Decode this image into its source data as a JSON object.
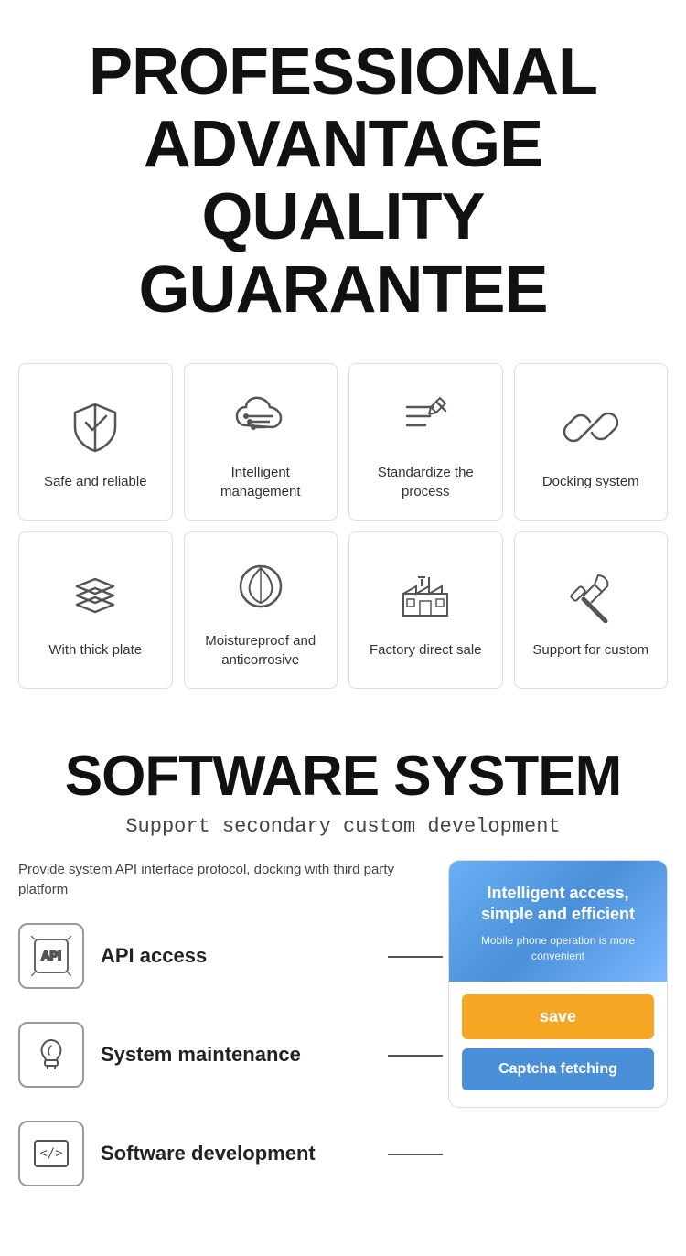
{
  "header": {
    "line1": "PROFESSIONAL",
    "line2": "ADVANTAGE",
    "line3": "QUALITY GUARANTEE"
  },
  "grid": {
    "row1": [
      {
        "id": "safe-reliable",
        "label": "Safe and reliable",
        "icon": "shield"
      },
      {
        "id": "intelligent-management",
        "label": "Intelligent management",
        "icon": "cloud-filter"
      },
      {
        "id": "standardize-process",
        "label": "Standardize the process",
        "icon": "pen-list"
      },
      {
        "id": "docking-system",
        "label": "Docking system",
        "icon": "link"
      }
    ],
    "row2": [
      {
        "id": "thick-plate",
        "label": "With thick plate",
        "icon": "layers"
      },
      {
        "id": "moistureproof",
        "label": "Moistureproof and anticorrosive",
        "icon": "leaf-shield"
      },
      {
        "id": "factory-direct",
        "label": "Factory direct sale",
        "icon": "factory"
      },
      {
        "id": "support-custom",
        "label": "Support for custom",
        "icon": "tools"
      }
    ]
  },
  "software": {
    "title": "SOFTWARE SYSTEM",
    "subtitle": "Support secondary custom development",
    "description": "Provide system API interface protocol, docking with third party platform",
    "items": [
      {
        "id": "api-access",
        "label": "API access",
        "icon": "api"
      },
      {
        "id": "system-maintenance",
        "label": "System maintenance",
        "icon": "drop-wrench"
      },
      {
        "id": "software-development",
        "label": "Software development",
        "icon": "code"
      }
    ],
    "panel": {
      "main_text": "Intelligent access, simple and efficient",
      "sub_text": "Mobile phone operation is more convenient",
      "save_btn": "save",
      "captcha_btn": "Captcha fetching"
    }
  }
}
